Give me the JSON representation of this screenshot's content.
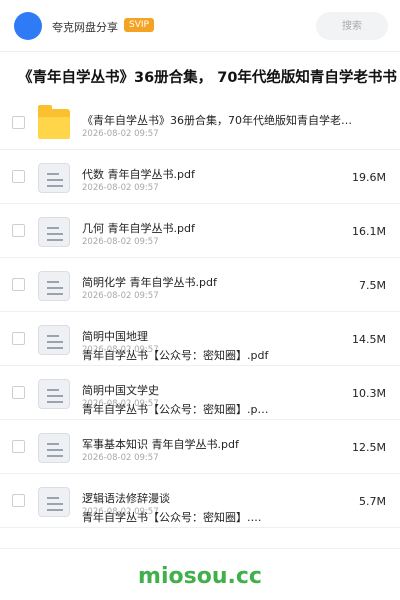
{
  "header": {
    "brand": "夸克网盘分享",
    "badge": "SVIP",
    "search_placeholder": "搜索"
  },
  "share": {
    "title": "《青年自学丛书》36册合集， 70年代绝版知青自学老书书"
  },
  "files": [
    {
      "type": "folder",
      "icon": "folder-icon",
      "lines": [
        "《青年自学丛书》36册合集，70年代绝版知青自学老…"
      ],
      "date": "2026-08-02 09:57",
      "size": ""
    },
    {
      "type": "file",
      "icon": "document-icon",
      "lines": [
        "代数 青年自学丛书.pdf"
      ],
      "date": "2026-08-02 09:57",
      "size": "19.6M"
    },
    {
      "type": "file",
      "icon": "document-icon",
      "lines": [
        "几何 青年自学丛书.pdf"
      ],
      "date": "2026-08-02 09:57",
      "size": "16.1M"
    },
    {
      "type": "file",
      "icon": "document-icon",
      "lines": [
        "简明化学 青年自学丛书.pdf"
      ],
      "date": "2026-08-02 09:57",
      "size": "7.5M"
    },
    {
      "type": "file",
      "icon": "document-icon",
      "lines": [
        "简明中国地理",
        "青年自学丛书【公众号：密知圈】.pdf"
      ],
      "date": "2026-08-02 09:57",
      "size": "14.5M"
    },
    {
      "type": "file",
      "icon": "document-icon",
      "lines": [
        "简明中国文学史",
        "青年自学丛书【公众号：密知圈】.p…"
      ],
      "date": "2026-08-02 09:57",
      "size": "10.3M"
    },
    {
      "type": "file",
      "icon": "document-icon",
      "lines": [
        "军事基本知识 青年自学丛书.pdf"
      ],
      "date": "2026-08-02 09:57",
      "size": "12.5M"
    },
    {
      "type": "file",
      "icon": "document-icon",
      "lines": [
        "逻辑语法修辞漫谈",
        "青年自学丛书【公众号：密知圈】.…"
      ],
      "date": "2026-08-02 09:57",
      "size": "5.7M"
    }
  ],
  "watermark": "miosou.cc",
  "colors": {
    "avatar": "#2f7bf6",
    "badge": "#f5a323",
    "folder": "#fbc02d",
    "watermark": "#41b04a"
  }
}
